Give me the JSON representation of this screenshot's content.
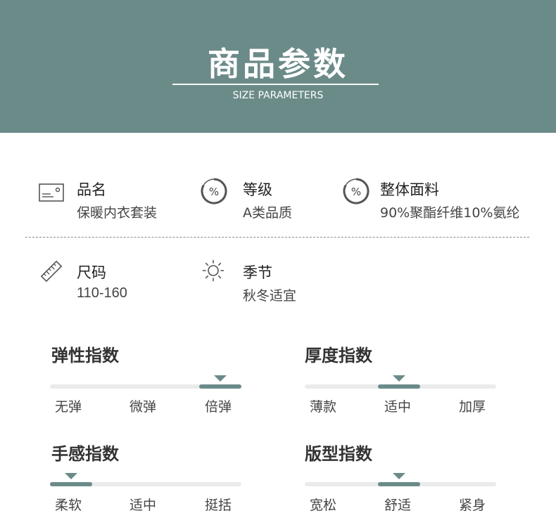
{
  "colors": {
    "accent": "#6b8b89",
    "track": "#ebebeb",
    "text": "#333333"
  },
  "header": {
    "title": "商品参数",
    "subtitle": "SIZE PARAMETERS"
  },
  "params": {
    "name": {
      "icon": "tag-card-icon",
      "title": "品名",
      "value": "保暖内衣套装"
    },
    "grade": {
      "icon": "percent-icon",
      "title": "等级",
      "value": "A类品质"
    },
    "fabric": {
      "icon": "percent-icon",
      "title": "整体面料",
      "value": "90%聚酯纤维10%氨纶"
    },
    "size": {
      "icon": "ruler-icon",
      "title": "尺码",
      "value": "110-160"
    },
    "season": {
      "icon": "sun-icon",
      "title": "季节",
      "value": "秋冬适宜"
    }
  },
  "indices": [
    {
      "title": "弹性指数",
      "labels": [
        "无弹",
        "微弹",
        "倍弹"
      ],
      "selected": 2
    },
    {
      "title": "厚度指数",
      "labels": [
        "薄款",
        "适中",
        "加厚"
      ],
      "selected": 1
    },
    {
      "title": "手感指数",
      "labels": [
        "柔软",
        "适中",
        "挺括"
      ],
      "selected": 0
    },
    {
      "title": "版型指数",
      "labels": [
        "宽松",
        "舒适",
        "紧身"
      ],
      "selected": 1
    }
  ]
}
